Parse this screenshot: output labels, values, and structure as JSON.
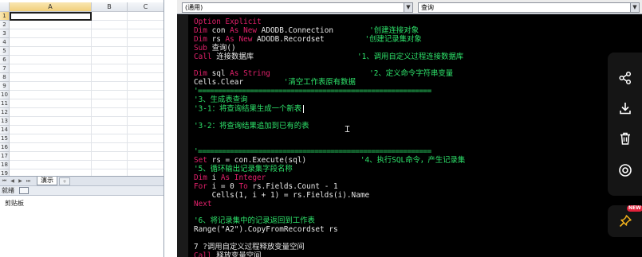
{
  "excel": {
    "columns": [
      "A",
      "B",
      "C"
    ],
    "rows": [
      "1",
      "2",
      "3",
      "4",
      "5",
      "6",
      "7",
      "8",
      "9",
      "10",
      "11",
      "12",
      "13",
      "14",
      "15",
      "16",
      "17",
      "18",
      "19"
    ],
    "active_cell_row": "1",
    "sheet_tab": "演示",
    "status_text": "就绪",
    "lower_label": "剪贴板"
  },
  "vba": {
    "object_combo": "(通用)",
    "proc_combo": "查询",
    "code_lines": [
      [
        {
          "t": "Option Explicit",
          "c": "kw"
        }
      ],
      [
        {
          "t": "Dim ",
          "c": "kw"
        },
        {
          "t": "con ",
          "c": "tx"
        },
        {
          "t": "As New ",
          "c": "kw"
        },
        {
          "t": "ADODB.Connection        ",
          "c": "tx"
        },
        {
          "t": "'创建连接对象",
          "c": "cm"
        }
      ],
      [
        {
          "t": "Dim ",
          "c": "kw"
        },
        {
          "t": "rs ",
          "c": "tx"
        },
        {
          "t": "As New ",
          "c": "kw"
        },
        {
          "t": "ADODB.Recordset         ",
          "c": "tx"
        },
        {
          "t": "'创建记录集对象",
          "c": "cm"
        }
      ],
      [
        {
          "t": "Sub ",
          "c": "kw"
        },
        {
          "t": "查询()",
          "c": "tx"
        }
      ],
      [
        {
          "t": "Call ",
          "c": "kw"
        },
        {
          "t": "连接数据库                       ",
          "c": "tx"
        },
        {
          "t": "'1、调用自定义过程连接数据库",
          "c": "cm"
        }
      ],
      [
        {
          "t": "",
          "c": "tx"
        }
      ],
      [
        {
          "t": "Dim ",
          "c": "kw"
        },
        {
          "t": "sql ",
          "c": "tx"
        },
        {
          "t": "As String                      ",
          "c": "kw"
        },
        {
          "t": "'2、定义命令字符串变量",
          "c": "cm"
        }
      ],
      [
        {
          "t": "Cells.Clear         ",
          "c": "tx"
        },
        {
          "t": "'清空工作表原有数据",
          "c": "cm"
        }
      ],
      [
        {
          "t": "'==========================================================",
          "c": "sep"
        }
      ],
      [
        {
          "t": "'3、生成表查询",
          "c": "cm"
        }
      ],
      [
        {
          "t": "'3-1：将查询结果生成一个新表",
          "c": "cm"
        },
        {
          "t": "",
          "c": "cursor"
        }
      ],
      [
        {
          "t": "",
          "c": "tx"
        }
      ],
      [
        {
          "t": "'3-2：将查询结果追加到已有的表",
          "c": "cm"
        }
      ],
      [
        {
          "t": "",
          "c": "tx"
        }
      ],
      [
        {
          "t": "",
          "c": "tx"
        }
      ],
      [
        {
          "t": "'==========================================================",
          "c": "sep"
        }
      ],
      [
        {
          "t": "Set ",
          "c": "kw"
        },
        {
          "t": "rs = con.Execute(sql)            ",
          "c": "tx"
        },
        {
          "t": "'4、执行SQL命令，产生记录集",
          "c": "cm"
        }
      ],
      [
        {
          "t": "'5、循环输出记录集字段名称",
          "c": "cm"
        }
      ],
      [
        {
          "t": "Dim ",
          "c": "kw"
        },
        {
          "t": "i ",
          "c": "tx"
        },
        {
          "t": "As Integer",
          "c": "kw"
        }
      ],
      [
        {
          "t": "For ",
          "c": "kw"
        },
        {
          "t": "i = 0 ",
          "c": "tx"
        },
        {
          "t": "To ",
          "c": "kw"
        },
        {
          "t": "rs.Fields.Count - 1",
          "c": "tx"
        }
      ],
      [
        {
          "t": "    Cells(1, i + 1) = rs.Fields(i).Name",
          "c": "tx"
        }
      ],
      [
        {
          "t": "Next",
          "c": "kw"
        }
      ],
      [
        {
          "t": "",
          "c": "tx"
        }
      ],
      [
        {
          "t": "'6、将记录集中的记录返回到工作表",
          "c": "cm"
        }
      ],
      [
        {
          "t": "Range(\"A2\").CopyFromRecordset rs",
          "c": "tx"
        }
      ],
      [
        {
          "t": "",
          "c": "tx"
        }
      ],
      [
        {
          "t": "7 ?调用自定义过程释放变量空间",
          "c": "tx"
        }
      ],
      [
        {
          "t": "Call ",
          "c": "kw"
        },
        {
          "t": "释放变量空间",
          "c": "tx"
        }
      ]
    ]
  },
  "float_toolbar": {
    "icons": [
      "share-icon",
      "download-icon",
      "delete-icon",
      "target-icon",
      "pin-icon"
    ],
    "badge": "NEW"
  },
  "colors": {
    "keyword": "#e0206a",
    "comment": "#2ee36b",
    "code_text": "#e8e8e8",
    "editor_bg": "#000000",
    "badge_red": "#e3213a"
  }
}
